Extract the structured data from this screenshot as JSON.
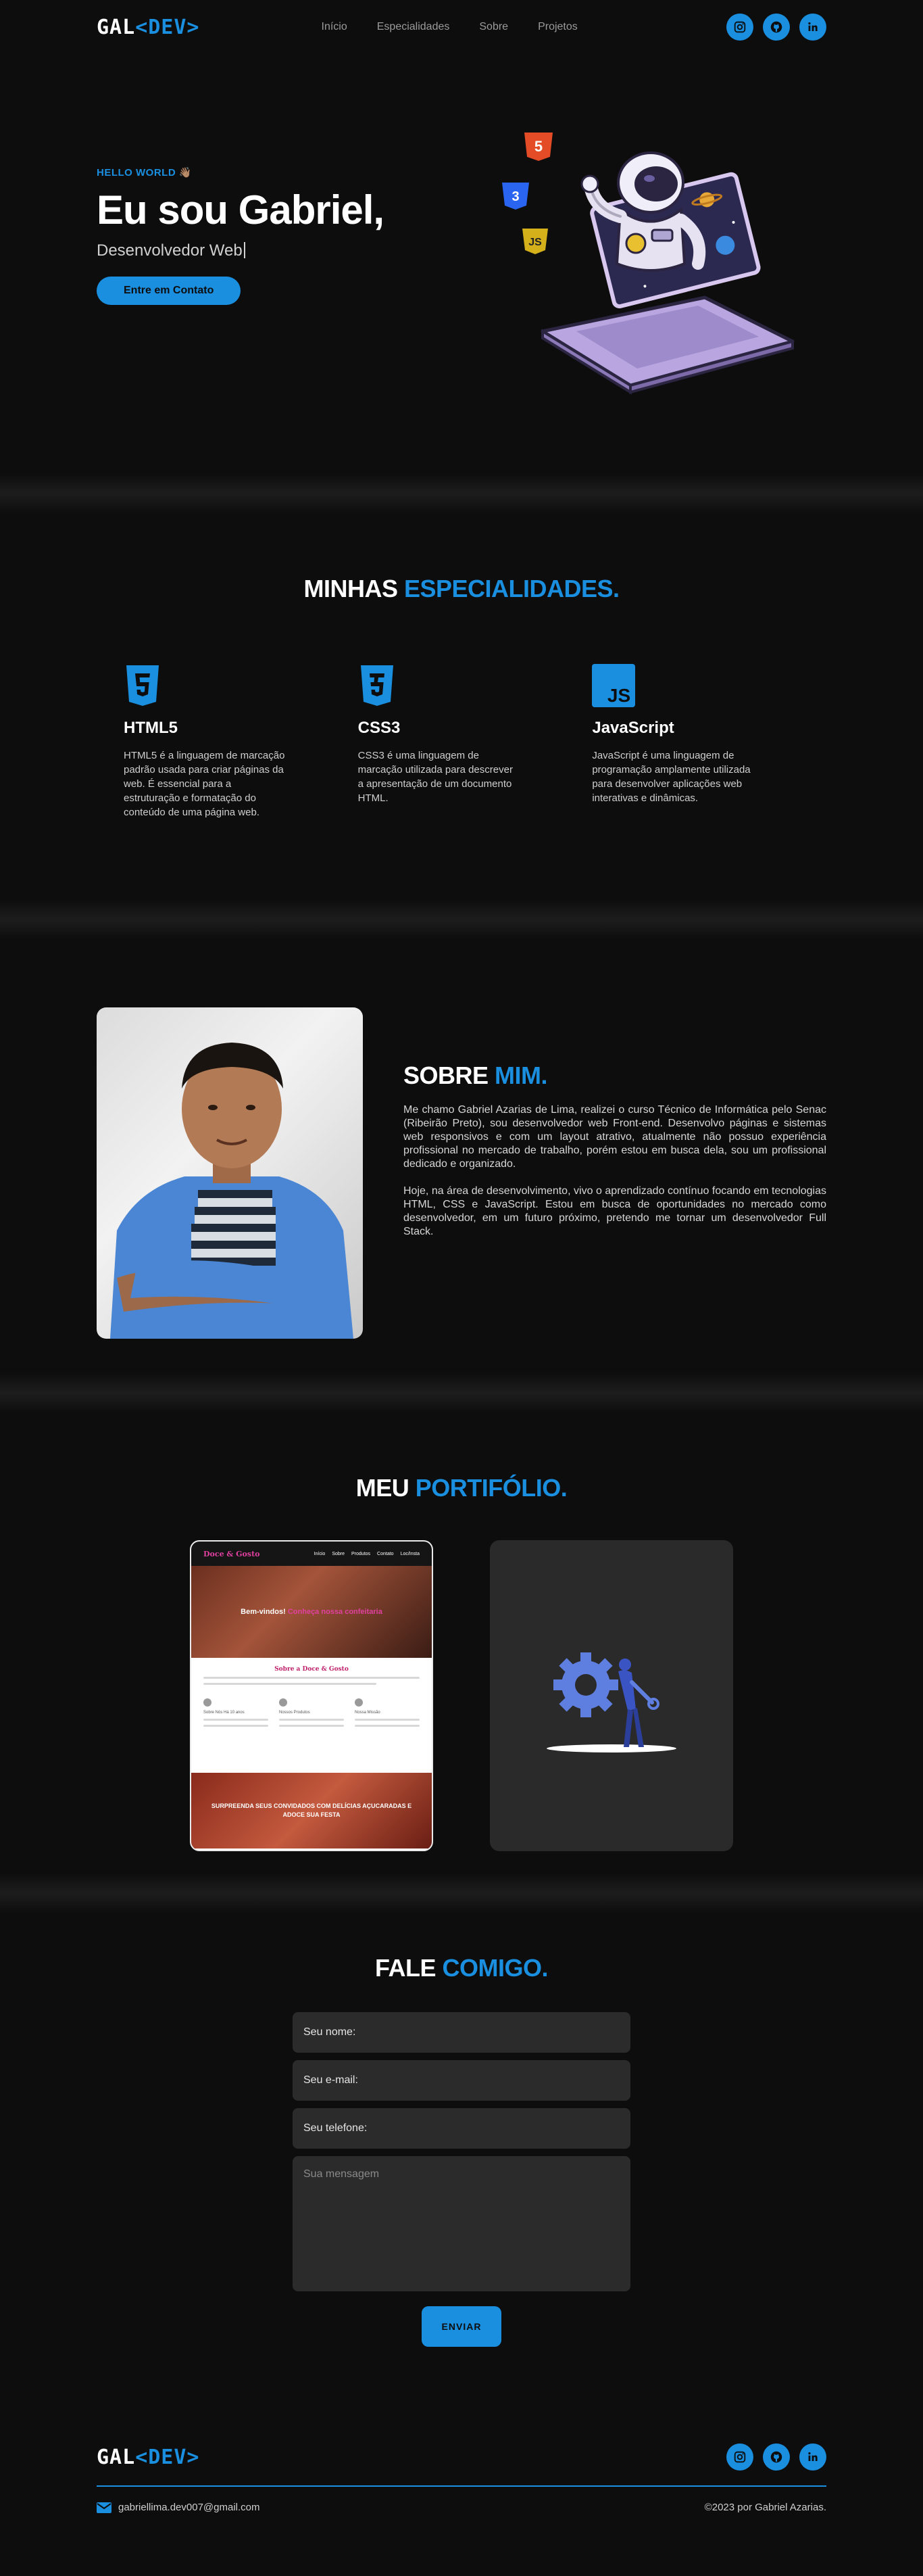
{
  "brand": {
    "logo_left": "GAL",
    "logo_right": "<DEV>"
  },
  "nav": {
    "items": [
      "Início",
      "Especialidades",
      "Sobre",
      "Projetos"
    ]
  },
  "socials": [
    "instagram-icon",
    "github-icon",
    "linkedin-icon"
  ],
  "hero": {
    "greeting": "HELLO WORLD",
    "greeting_emoji": "👋🏽",
    "title": "Eu sou Gabriel,",
    "subtitle": "Desenvolvedor Web",
    "cta": "Entre em Contato",
    "badges": [
      "5",
      "3",
      "JS"
    ]
  },
  "specialties": {
    "title_a": "MINHAS",
    "title_b": "ESPECIALIDADES.",
    "cards": [
      {
        "icon": "html5-icon",
        "title": "HTML5",
        "text": "HTML5 é a linguagem de marcação padrão usada para criar páginas da web. É essencial para a estruturação e formatação do conteúdo de uma página web."
      },
      {
        "icon": "css3-icon",
        "title": "CSS3",
        "text": "CSS3 é uma linguagem de marcação utilizada para descrever a apresentação de um documento HTML."
      },
      {
        "icon": "javascript-icon",
        "title": "JavaScript",
        "text": "JavaScript é uma linguagem de programação amplamente utilizada para desenvolver aplicações web interativas e dinâmicas."
      }
    ]
  },
  "about": {
    "title_a": "SOBRE",
    "title_b": "MIM.",
    "p1": "Me chamo Gabriel Azarias de Lima, realizei o curso Técnico de Informática pelo Senac (Ribeirão Preto), sou desenvolvedor web Front-end. Desenvolvo páginas e sistemas web responsivos e com um layout atrativo, atualmente não possuo experiência profissional no mercado de trabalho, porém estou em busca dela, sou um profissional dedicado e organizado.",
    "p2": "Hoje, na área de desenvolvimento, vivo o aprendizado contínuo focando em tecnologias HTML, CSS e JavaScript. Estou em busca de oportunidades no mercado como desenvolvedor, em um futuro próximo, pretendo me tornar um desenvolvedor Full Stack."
  },
  "portfolio": {
    "title_a": "MEU",
    "title_b": "PORTIFÓLIO.",
    "project1": {
      "logo": "Doce & Gosto",
      "links": [
        "Início",
        "Sobre",
        "Produtos",
        "Contato",
        "Loc/Insta"
      ],
      "hero_a": "Bem-vindos!",
      "hero_b": "Conheça nossa confeitaria",
      "about_title": "Sobre a Doce & Gosto",
      "cols": [
        "Sobre Nós Há 10 anos",
        "Nossos Produtos",
        "Nossa Missão"
      ],
      "banner": "SURPREENDA SEUS CONVIDADOS COM DELÍCIAS AÇUCARADAS E ADOCE SUA FESTA"
    }
  },
  "contact": {
    "title_a": "FALE",
    "title_b": "COMIGO.",
    "name_placeholder": "Seu nome:",
    "email_placeholder": "Seu e-mail:",
    "phone_placeholder": "Seu telefone:",
    "message_placeholder": "Sua mensagem",
    "send": "ENVIAR"
  },
  "footer": {
    "email": "gabriellima.dev007@gmail.com",
    "copyright": "©2023 por Gabriel Azarias."
  },
  "colors": {
    "accent": "#1a8fe0",
    "background": "#0d0d0d",
    "field": "#2b2b2b"
  }
}
